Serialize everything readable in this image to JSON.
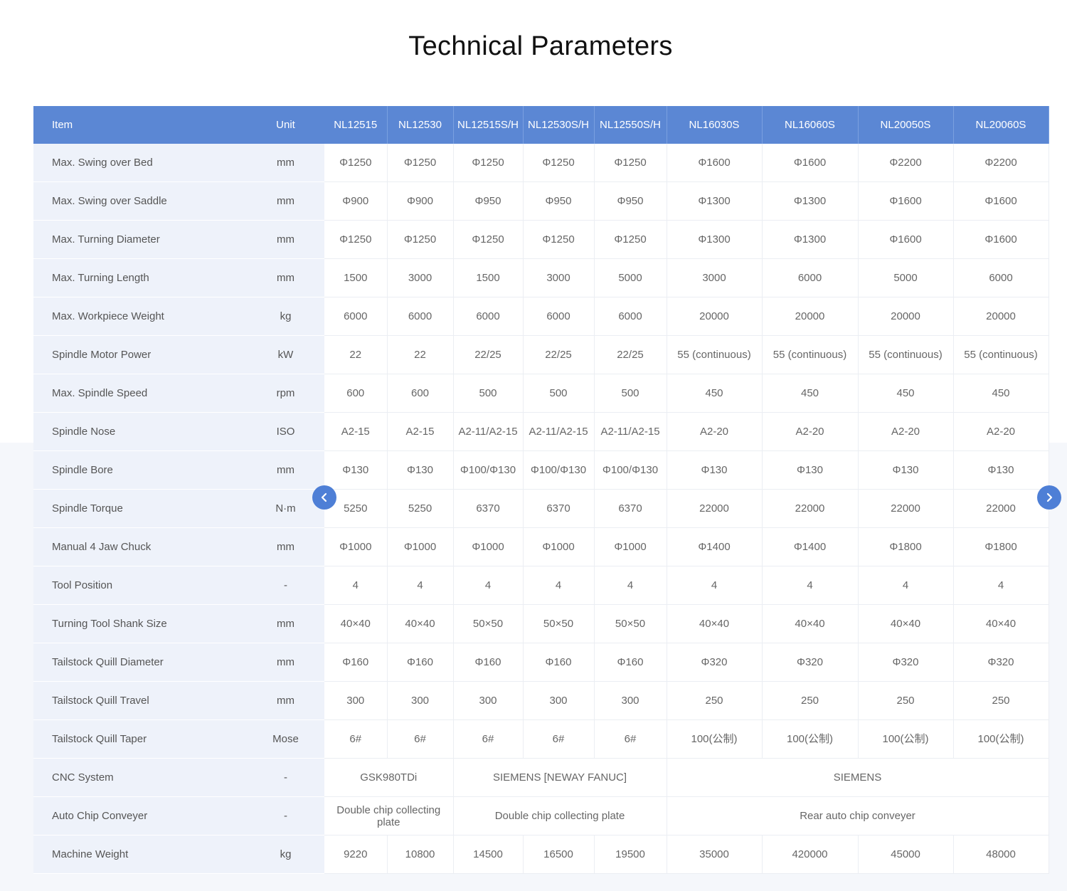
{
  "page": {
    "title": "Technical Parameters"
  },
  "table": {
    "headers": [
      "Item",
      "Unit",
      "NL12515",
      "NL12530",
      "NL12515S/H",
      "NL12530S/H",
      "NL12550S/H",
      "NL16030S",
      "NL16060S",
      "NL20050S",
      "NL20060S"
    ],
    "rows": [
      {
        "item": "Max. Swing  over Bed",
        "unit": "mm",
        "values": [
          "Φ1250",
          "Φ1250",
          "Φ1250",
          "Φ1250",
          "Φ1250",
          "Φ1600",
          "Φ1600",
          "Φ2200",
          "Φ2200"
        ]
      },
      {
        "item": "Max. Swing  over Saddle",
        "unit": "mm",
        "values": [
          "Φ900",
          "Φ900",
          "Φ950",
          "Φ950",
          "Φ950",
          "Φ1300",
          "Φ1300",
          "Φ1600",
          "Φ1600"
        ]
      },
      {
        "item": "Max. Turning  Diameter",
        "unit": "mm",
        "values": [
          "Φ1250",
          "Φ1250",
          "Φ1250",
          "Φ1250",
          "Φ1250",
          "Φ1300",
          "Φ1300",
          "Φ1600",
          "Φ1600"
        ]
      },
      {
        "item": "Max. Turning  Length",
        "unit": "mm",
        "values": [
          "1500",
          "3000",
          "1500",
          "3000",
          "5000",
          "3000",
          "6000",
          "5000",
          "6000"
        ]
      },
      {
        "item": "Max.  Workpiece Weight",
        "unit": "kg",
        "values": [
          "6000",
          "6000",
          "6000",
          "6000",
          "6000",
          "20000",
          "20000",
          "20000",
          "20000"
        ]
      },
      {
        "item": "Spindle Motor  Power",
        "unit": "kW",
        "values": [
          "22",
          "22",
          "22/25",
          "22/25",
          "22/25",
          "55 (continuous)",
          "55 (continuous)",
          "55 (continuous)",
          "55 (continuous)"
        ]
      },
      {
        "item": "Max. Spindle Speed",
        "unit": "rpm",
        "values": [
          "600",
          "600",
          "500",
          "500",
          "500",
          "450",
          "450",
          "450",
          "450"
        ]
      },
      {
        "item": "Spindle Nose",
        "unit": "ISO",
        "values": [
          "A2-15",
          "A2-15",
          "A2-11/A2-15",
          "A2-11/A2-15",
          "A2-11/A2-15",
          "A2-20",
          "A2-20",
          "A2-20",
          "A2-20"
        ]
      },
      {
        "item": "Spindle Bore",
        "unit": "mm",
        "values": [
          "Φ130",
          "Φ130",
          "Φ100/Φ130",
          "Φ100/Φ130",
          "Φ100/Φ130",
          "Φ130",
          "Φ130",
          "Φ130",
          "Φ130"
        ]
      },
      {
        "item": "Spindle  Torque",
        "unit": "N·m",
        "values": [
          "5250",
          "5250",
          "6370",
          "6370",
          "6370",
          "22000",
          "22000",
          "22000",
          "22000"
        ]
      },
      {
        "item": "Manual 4 Jaw Chuck",
        "unit": "mm",
        "values": [
          "Φ1000",
          "Φ1000",
          "Φ1000",
          "Φ1000",
          "Φ1000",
          "Φ1400",
          "Φ1400",
          "Φ1800",
          "Φ1800"
        ]
      },
      {
        "item": "Tool Position",
        "unit": "-",
        "values": [
          "4",
          "4",
          "4",
          "4",
          "4",
          "4",
          "4",
          "4",
          "4"
        ]
      },
      {
        "item": "Turning Tool  Shank Size",
        "unit": "mm",
        "values": [
          "40×40",
          "40×40",
          "50×50",
          "50×50",
          "50×50",
          "40×40",
          "40×40",
          "40×40",
          "40×40"
        ]
      },
      {
        "item": "Tailstock  Quill Diameter",
        "unit": "mm",
        "values": [
          "Φ160",
          "Φ160",
          "Φ160",
          "Φ160",
          "Φ160",
          "Φ320",
          "Φ320",
          "Φ320",
          "Φ320"
        ]
      },
      {
        "item": "Tailstock Quill Travel",
        "unit": "mm",
        "values": [
          "300",
          "300",
          "300",
          "300",
          "300",
          "250",
          "250",
          "250",
          "250"
        ]
      },
      {
        "item": "Tailstock  Quill Taper",
        "unit": "Mose",
        "values": [
          "6#",
          "6#",
          "6#",
          "6#",
          "6#",
          "100(公制)",
          "100(公制)",
          "100(公制)",
          "100(公制)"
        ]
      }
    ],
    "spanned_rows": [
      {
        "item": "CNC System",
        "unit": "-",
        "groups": [
          {
            "text": "GSK980TDi",
            "span": 2
          },
          {
            "text": "SIEMENS [NEWAY FANUC]",
            "span": 3
          },
          {
            "text": "SIEMENS",
            "span": 4
          }
        ]
      },
      {
        "item": "Auto Chip  Conveyer",
        "unit": "-",
        "groups": [
          {
            "text": "Double chip  collecting plate",
            "span": 2
          },
          {
            "text": "Double chip collecting plate",
            "span": 3
          },
          {
            "text": "Rear auto chip conveyer",
            "span": 4
          }
        ]
      }
    ],
    "last_row": {
      "item": "Machine  Weight",
      "unit": "kg",
      "values": [
        "9220",
        "10800",
        "14500",
        "16500",
        "19500",
        "35000",
        "420000",
        "45000",
        "48000"
      ]
    }
  },
  "carousel": {
    "prev_icon": "chevron-left-icon",
    "next_icon": "chevron-right-icon",
    "accent_color": "#4e7fd6",
    "header_color": "#5b87d4"
  }
}
